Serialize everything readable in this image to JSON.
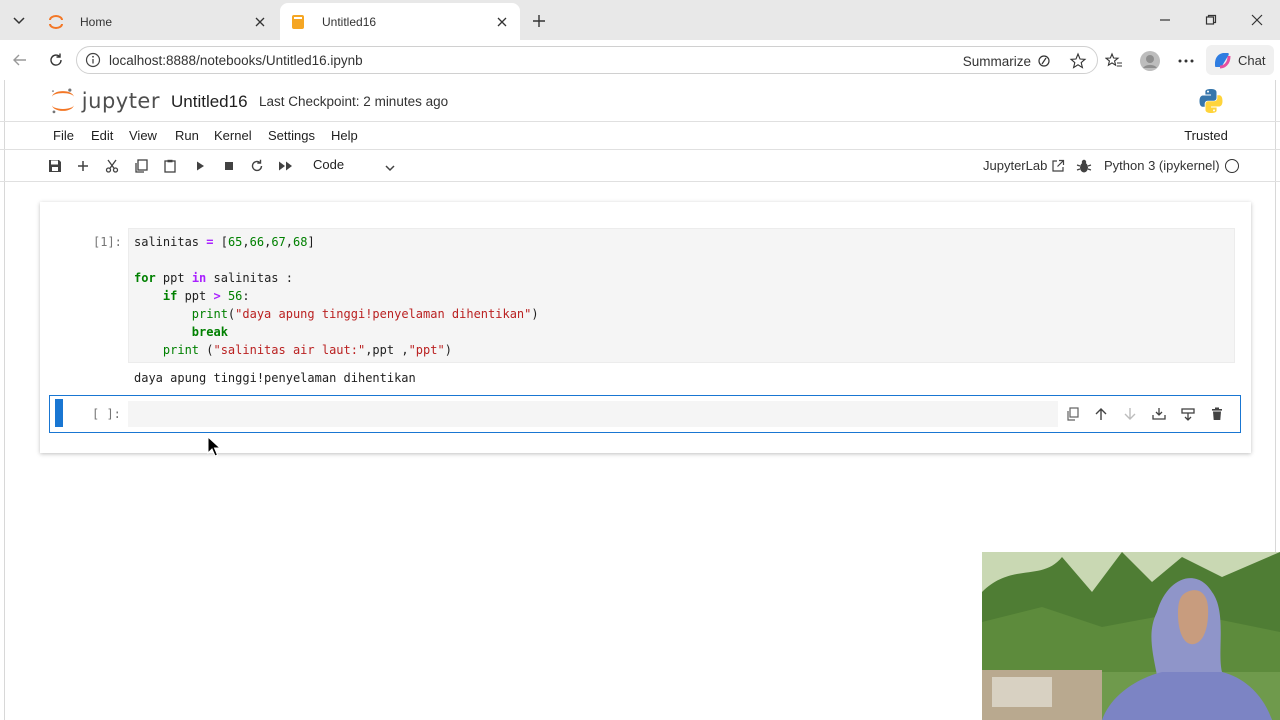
{
  "browser": {
    "tabs": [
      {
        "title": "Home",
        "active": false
      },
      {
        "title": "Untitled16",
        "active": true
      }
    ],
    "url": "localhost:8888/notebooks/Untitled16.ipynb",
    "summarize_label": "Summarize",
    "chat_label": "Chat"
  },
  "jupyter": {
    "logo_text": "jupyter",
    "notebook_title": "Untitled16",
    "checkpoint": "Last Checkpoint: 2 minutes ago",
    "menu": [
      "File",
      "Edit",
      "View",
      "Run",
      "Kernel",
      "Settings",
      "Help"
    ],
    "trusted": "Trusted",
    "cell_type": "Code",
    "jupyterlab_link": "JupyterLab",
    "kernel": "Python 3 (ipykernel)"
  },
  "cells": {
    "cell1": {
      "prompt": "[1]:",
      "lines": [
        "salinitas = [65,66,67,68]",
        "",
        "for ppt in salinitas :",
        "    if ppt > 56:",
        "        print(\"daya apung tinggi!penyelaman dihentikan\")",
        "        break",
        "    print (\"salinitas air laut:\",ppt ,\"ppt\")"
      ],
      "output": "daya apung tinggi!penyelaman dihentikan"
    },
    "cell2": {
      "prompt": "[ ]:"
    }
  },
  "colors": {
    "accent": "#1976d2",
    "keyword": "#008000",
    "string": "#ba2121",
    "operator": "#aa22ff"
  }
}
